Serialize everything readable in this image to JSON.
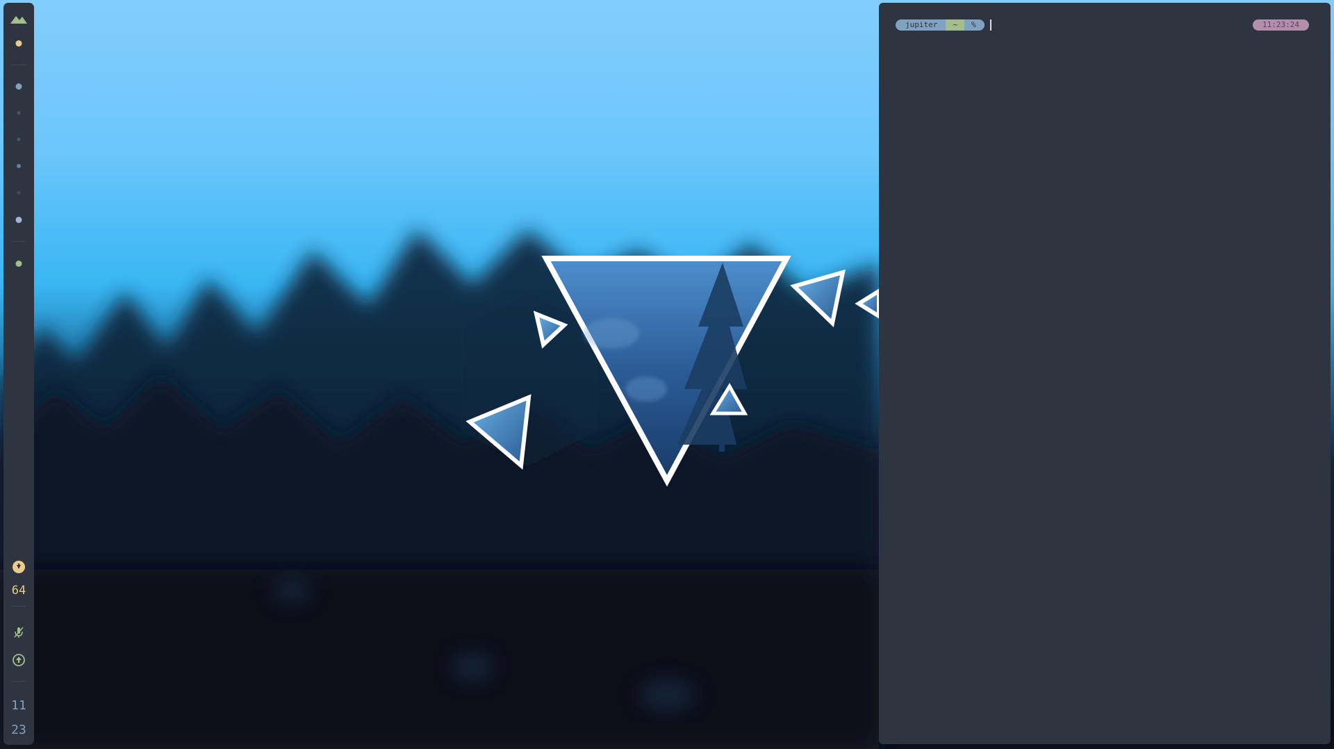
{
  "colors": {
    "bar_bg": "#2e3440",
    "terminal_bg": "#2e3440",
    "accent_yellow": "#ebcb8b",
    "accent_blue": "#81a1c1",
    "accent_green": "#a3be8c",
    "accent_purple": "#b48ead",
    "text_light": "#d8dee9"
  },
  "bar": {
    "logo_icon": "mountain-icon",
    "workspaces": [
      {
        "state": "active",
        "color": "#ebcb8b"
      },
      {
        "state": "occupied",
        "color": "#81a1c1"
      },
      {
        "state": "empty",
        "color": "#4c566a"
      },
      {
        "state": "empty",
        "color": "#4c566a"
      },
      {
        "state": "occupied",
        "color": "#5e81ac"
      },
      {
        "state": "empty",
        "color": "#434c5e"
      },
      {
        "state": "occupied",
        "color": "#a3b3d6"
      },
      {
        "state": "occupied",
        "color": "#a3be8c"
      }
    ],
    "volume_icon": "volume-icon",
    "volume_value": "64",
    "mic_icon": "mic-muted-icon",
    "update_icon": "arrow-up-circle-icon",
    "clock_hour": "11",
    "clock_minute": "23"
  },
  "terminal": {
    "prompt_host": "jupiter",
    "prompt_dir": "~",
    "prompt_symbol": "%",
    "rprompt_time": "11:23:24"
  }
}
